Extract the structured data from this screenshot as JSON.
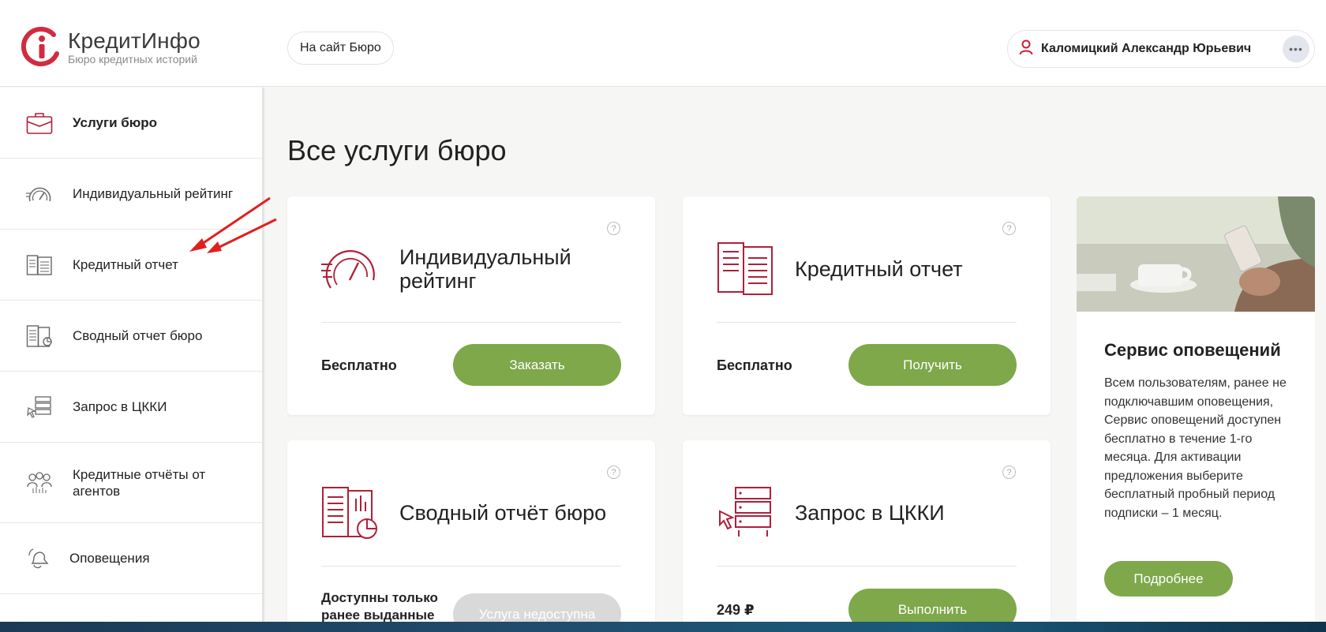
{
  "brand": {
    "name": "КредитИнфо",
    "subtitle": "Бюро кредитных историй",
    "color": "#c8203a"
  },
  "header": {
    "site_button": "На сайт Бюро",
    "user_name": "Каломицкий Александр Юрьевич",
    "more": "•••"
  },
  "sidebar": {
    "items": [
      {
        "label": "Услуги бюро",
        "icon": "briefcase-icon",
        "active": true
      },
      {
        "label": "Индивидуальный рейтинг",
        "icon": "speedometer-icon"
      },
      {
        "label": "Кредитный отчет",
        "icon": "report-icon"
      },
      {
        "label": "Сводный отчет бюро",
        "icon": "summary-report-icon"
      },
      {
        "label": "Запрос в ЦККИ",
        "icon": "server-request-icon"
      },
      {
        "label": "Кредитные отчёты от агентов",
        "icon": "agents-icon"
      },
      {
        "label": "Оповещения",
        "icon": "bell-icon"
      }
    ]
  },
  "main": {
    "title": "Все услуги бюро",
    "cards": [
      {
        "title": "Индивидуальный рейтинг",
        "price": "Бесплатно",
        "button": "Заказать"
      },
      {
        "title": "Кредитный отчет",
        "price": "Бесплатно",
        "button": "Получить"
      },
      {
        "title": "Сводный отчёт бюро",
        "price": "Доступны только ранее выданные",
        "button": "Услуга недоступна"
      },
      {
        "title": "Запрос в ЦККИ",
        "price": "249 ₽",
        "button": "Выполнить"
      }
    ],
    "help": "?"
  },
  "promo": {
    "title": "Сервис оповещений",
    "text": "Всем пользователям, ранее не подключавшим оповещения, Сервис оповещений доступен бесплатно в течение 1-го месяца. Для активации предложения выберите бесплатный пробный период подписки – 1 месяц.",
    "button": "Подробнее"
  },
  "colors": {
    "accent_green": "#7ea84a",
    "icon_red": "#b0203a",
    "annotation_arrow": "#e02020"
  }
}
